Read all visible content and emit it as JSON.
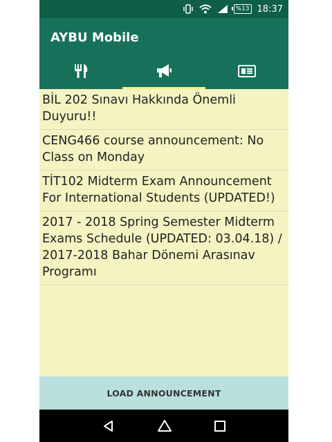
{
  "status_bar": {
    "battery": "%13",
    "time": "18:37",
    "icons": [
      "vibrate-icon",
      "wifi-icon",
      "signal-icon",
      "battery-icon"
    ]
  },
  "app_bar": {
    "title": "AYBU Mobile",
    "color": "#17715a",
    "status_color": "#0f5e47"
  },
  "tabs": [
    {
      "icon": "restaurant-icon",
      "active": false
    },
    {
      "icon": "megaphone-icon",
      "active": true
    },
    {
      "icon": "newspaper-icon",
      "active": false
    }
  ],
  "announcements": [
    {
      "text": "BİL 202 Sınavı Hakkında Önemli Duyuru!!"
    },
    {
      "text": "CENG466 course announcement: No Class on Monday"
    },
    {
      "text": "TİT102 Midterm Exam Announcement For International Students (UPDATED!)"
    },
    {
      "text": "2017 - 2018 Spring Semester Midterm Exams Schedule (UPDATED: 03.04.18) / 2017-2018 Bahar Dönemi Arasınav Programı"
    }
  ],
  "load_button": {
    "label": "LOAD ANNOUNCEMENT"
  },
  "nav": {
    "icons": [
      "back-icon",
      "home-icon",
      "recents-icon"
    ]
  },
  "colors": {
    "background": "#f4f3c2",
    "tab_indicator": "#f2f08c",
    "button": "#b9e0dd"
  }
}
